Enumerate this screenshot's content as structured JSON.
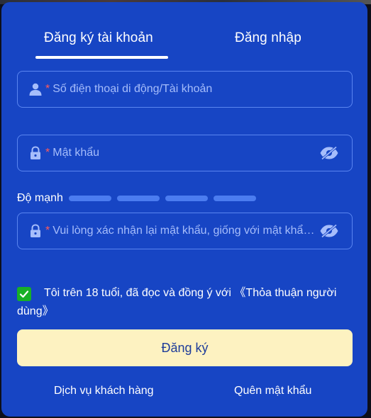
{
  "tabs": {
    "register": "Đăng ký tài khoản",
    "login": "Đăng nhập"
  },
  "fields": {
    "account_placeholder": "Số điện thoại di động/Tài khoản",
    "password_placeholder": "Mật khẩu",
    "confirm_placeholder": "Vui lòng xác nhận lại mật khẩu, giống với mật khẩu đã nhập",
    "required_mark": "*"
  },
  "strength": {
    "label": "Độ mạnh",
    "level": 0
  },
  "agreement": {
    "checked": true,
    "text": "Tôi trên 18 tuổi, đã đọc và đồng ý với ",
    "terms": "《Thỏa thuận người dùng》"
  },
  "submit_label": "Đăng ký",
  "footer": {
    "customer_service": "Dịch vụ khách hàng",
    "forgot_password": "Quên mật khẩu"
  },
  "colors": {
    "modal_bg": "#1745c4",
    "field_border": "#5a85f0",
    "placeholder": "#a6bdfb",
    "required": "#ff5a5a",
    "checkbox": "#17b026",
    "submit_bg": "#fdf2c1",
    "submit_text": "#1f3d9a",
    "strength_bar": "#4b7cf0"
  },
  "icons": {
    "account": "user-icon",
    "password": "lock-icon",
    "visibility": "eye-off-icon",
    "check": "check-icon"
  }
}
